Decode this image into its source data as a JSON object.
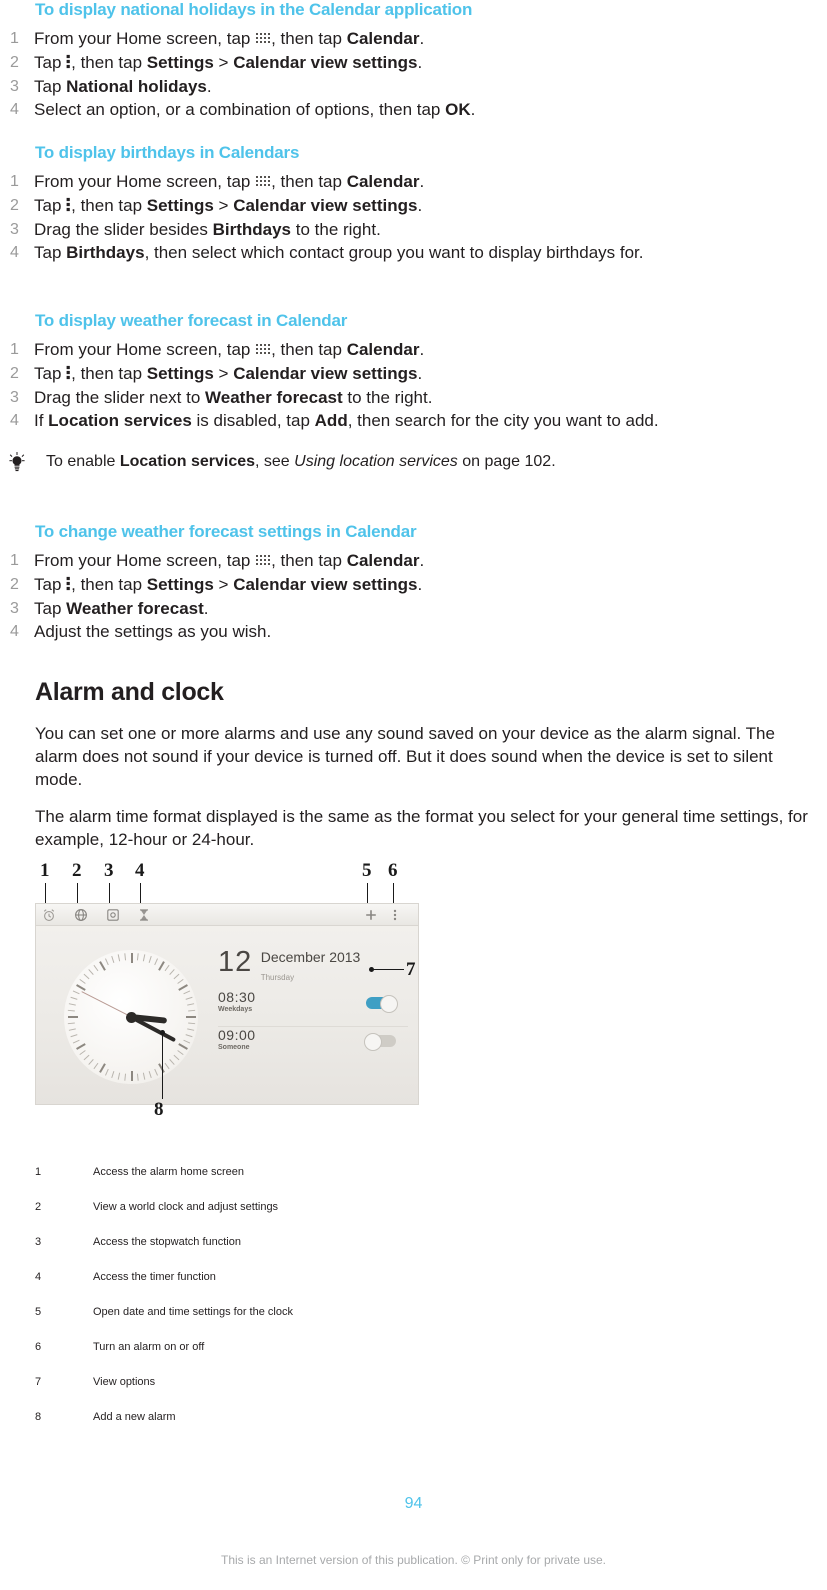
{
  "sections": [
    {
      "heading": "To display national holidays in the Calendar application",
      "steps": [
        {
          "num": "1",
          "parts": [
            {
              "t": "From your Home screen, tap "
            },
            {
              "icon": "apps-grid-icon"
            },
            {
              "t": ", then tap "
            },
            {
              "t": "Calendar",
              "b": true
            },
            {
              "t": "."
            }
          ]
        },
        {
          "num": "2",
          "parts": [
            {
              "t": "Tap "
            },
            {
              "icon": "overflow-menu-icon"
            },
            {
              "t": ", then tap "
            },
            {
              "t": "Settings",
              "b": true
            },
            {
              "t": " > "
            },
            {
              "t": "Calendar view settings",
              "b": true
            },
            {
              "t": "."
            }
          ]
        },
        {
          "num": "3",
          "parts": [
            {
              "t": "Tap "
            },
            {
              "t": "National holidays",
              "b": true
            },
            {
              "t": "."
            }
          ]
        },
        {
          "num": "4",
          "parts": [
            {
              "t": "Select an option, or a combination of options, then tap "
            },
            {
              "t": "OK",
              "b": true
            },
            {
              "t": "."
            }
          ]
        }
      ]
    },
    {
      "heading": "To display birthdays in Calendars",
      "steps": [
        {
          "num": "1",
          "parts": [
            {
              "t": "From your Home screen, tap "
            },
            {
              "icon": "apps-grid-icon"
            },
            {
              "t": ", then tap "
            },
            {
              "t": "Calendar",
              "b": true
            },
            {
              "t": "."
            }
          ]
        },
        {
          "num": "2",
          "parts": [
            {
              "t": "Tap "
            },
            {
              "icon": "overflow-menu-icon"
            },
            {
              "t": ", then tap "
            },
            {
              "t": "Settings",
              "b": true
            },
            {
              "t": " > "
            },
            {
              "t": "Calendar view settings",
              "b": true
            },
            {
              "t": "."
            }
          ]
        },
        {
          "num": "3",
          "parts": [
            {
              "t": "Drag the slider besides "
            },
            {
              "t": "Birthdays",
              "b": true
            },
            {
              "t": " to the right."
            }
          ]
        },
        {
          "num": "4",
          "parts": [
            {
              "t": "Tap "
            },
            {
              "t": "Birthdays",
              "b": true
            },
            {
              "t": ", then select which contact group you want to display birthdays for."
            }
          ]
        }
      ]
    },
    {
      "heading": "To display weather forecast in Calendar",
      "steps": [
        {
          "num": "1",
          "parts": [
            {
              "t": "From your Home screen, tap "
            },
            {
              "icon": "apps-grid-icon"
            },
            {
              "t": ", then tap "
            },
            {
              "t": "Calendar",
              "b": true
            },
            {
              "t": "."
            }
          ]
        },
        {
          "num": "2",
          "parts": [
            {
              "t": "Tap "
            },
            {
              "icon": "overflow-menu-icon"
            },
            {
              "t": ", then tap "
            },
            {
              "t": "Settings",
              "b": true
            },
            {
              "t": " > "
            },
            {
              "t": "Calendar view settings",
              "b": true
            },
            {
              "t": "."
            }
          ]
        },
        {
          "num": "3",
          "parts": [
            {
              "t": "Drag the slider next to "
            },
            {
              "t": "Weather forecast",
              "b": true
            },
            {
              "t": " to the right."
            }
          ]
        },
        {
          "num": "4",
          "parts": [
            {
              "t": "If "
            },
            {
              "t": "Location services",
              "b": true
            },
            {
              "t": " is disabled, tap "
            },
            {
              "t": "Add",
              "b": true
            },
            {
              "t": ", then search for the city you want to add."
            }
          ]
        }
      ],
      "tip": {
        "icon": "lightbulb-icon",
        "parts": [
          {
            "t": "To enable "
          },
          {
            "t": "Location services",
            "b": true
          },
          {
            "t": ", see "
          },
          {
            "t": "Using location services",
            "i": true
          },
          {
            "t": " on page 102."
          }
        ]
      }
    },
    {
      "heading": "To change weather forecast settings in Calendar",
      "steps": [
        {
          "num": "1",
          "parts": [
            {
              "t": "From your Home screen, tap "
            },
            {
              "icon": "apps-grid-icon"
            },
            {
              "t": ", then tap "
            },
            {
              "t": "Calendar",
              "b": true
            },
            {
              "t": "."
            }
          ]
        },
        {
          "num": "2",
          "parts": [
            {
              "t": "Tap "
            },
            {
              "icon": "overflow-menu-icon"
            },
            {
              "t": ", then tap "
            },
            {
              "t": "Settings",
              "b": true
            },
            {
              "t": " > "
            },
            {
              "t": "Calendar view settings",
              "b": true
            },
            {
              "t": "."
            }
          ]
        },
        {
          "num": "3",
          "parts": [
            {
              "t": "Tap "
            },
            {
              "t": "Weather forecast",
              "b": true
            },
            {
              "t": "."
            }
          ]
        },
        {
          "num": "4",
          "parts": [
            {
              "t": "Adjust the settings as you wish."
            }
          ]
        }
      ]
    }
  ],
  "alarm_section": {
    "heading": "Alarm and clock",
    "paragraphs": [
      "You can set one or more alarms and use any sound saved on your device as the alarm signal. The alarm does not sound if your device is turned off. But it does sound when the device is set to silent mode.",
      "The alarm time format displayed is the same as the format you select for your general time settings, for example, 12-hour or 24-hour."
    ]
  },
  "figure": {
    "callout_numbers_top": [
      "1",
      "2",
      "3",
      "4",
      "5",
      "6"
    ],
    "callout_number_right": "7",
    "callout_number_bottom": "8",
    "toolbar_icons": [
      "alarm-icon",
      "world-clock-icon",
      "stopwatch-icon",
      "timer-icon",
      "add-alarm-icon",
      "overflow-menu-icon"
    ],
    "screen": {
      "date_number": "12",
      "month_year": "December 2013",
      "weekday": "Thursday",
      "alarms": [
        {
          "time": "08:30",
          "meridiem": "",
          "repeat": "Weekdays",
          "enabled": "on"
        },
        {
          "time": "09:00",
          "meridiem": "",
          "repeat": "Someone",
          "enabled": "off"
        }
      ]
    }
  },
  "legend": {
    "rows": [
      {
        "num": "1",
        "desc": "Access the alarm home screen"
      },
      {
        "num": "2",
        "desc": "View a world clock and adjust settings"
      },
      {
        "num": "3",
        "desc": "Access the stopwatch function"
      },
      {
        "num": "4",
        "desc": "Access the timer function"
      },
      {
        "num": "5",
        "desc": "Open date and time settings for the clock"
      },
      {
        "num": "6",
        "desc": "Turn an alarm on or off"
      },
      {
        "num": "7",
        "desc": "View options"
      },
      {
        "num": "8",
        "desc": "Add a new alarm"
      }
    ]
  },
  "footer": {
    "page_number": "94",
    "copyright": "This is an Internet version of this publication. © Print only for private use."
  },
  "colors": {
    "heading_blue": "#4fc3ea",
    "body_text": "#231f20",
    "step_number": "#9a9a9a",
    "footer_gray": "#a7a9ab"
  }
}
